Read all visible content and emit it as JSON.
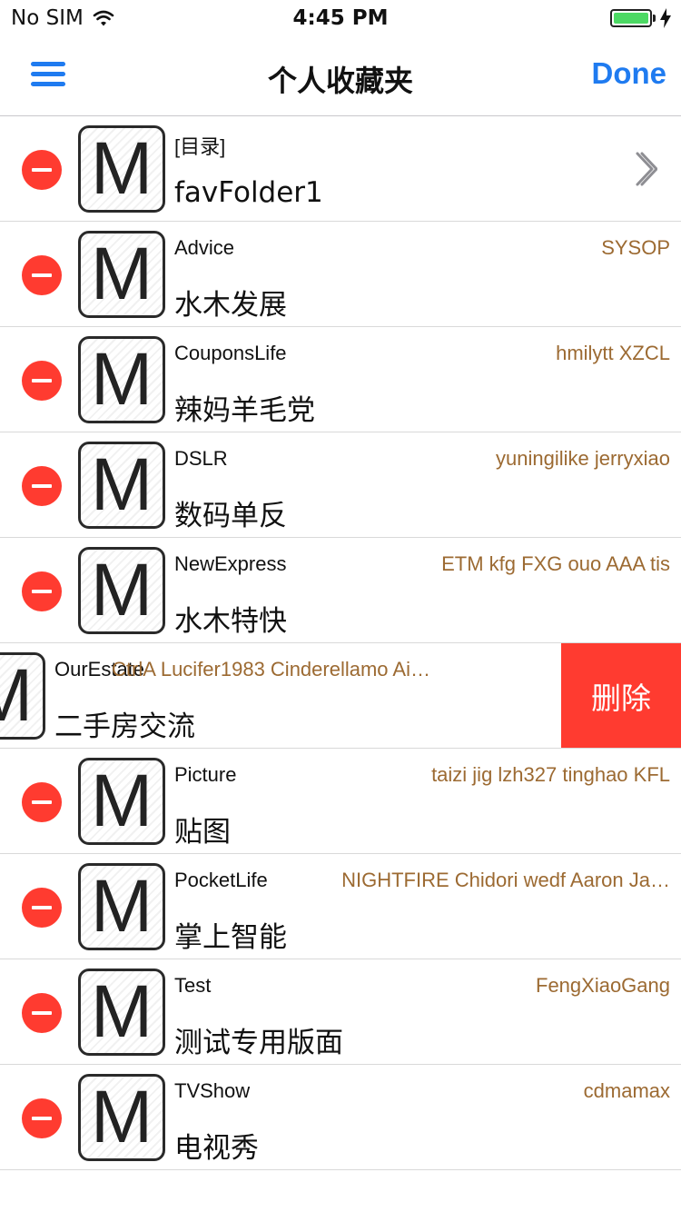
{
  "status": {
    "carrier": "No SIM",
    "time": "4:45 PM",
    "battery_level": 1.0
  },
  "nav": {
    "title": "个人收藏夹",
    "done_label": "Done",
    "menu_icon": "hamburger-menu-icon"
  },
  "colors": {
    "accent": "#1f7bf0",
    "delete": "#ff3b30",
    "moderator_text": "#9c6a32"
  },
  "rows": [
    {
      "name": "[目录]",
      "title": "favFolder1",
      "moderators": "",
      "icon_letter": "M",
      "is_folder": true
    },
    {
      "name": "Advice",
      "title": "水木发展",
      "moderators": "SYSOP",
      "icon_letter": "M"
    },
    {
      "name": "CouponsLife",
      "title": "辣妈羊毛党",
      "moderators": "hmilytt XZCL",
      "icon_letter": "M"
    },
    {
      "name": "DSLR",
      "title": "数码单反",
      "moderators": "yuningilike jerryxiao",
      "icon_letter": "M"
    },
    {
      "name": "NewExpress",
      "title": "水木特快",
      "moderators": "ETM kfg FXG ouo AAA tis",
      "icon_letter": "M"
    },
    {
      "name": "OurEstate",
      "title": "二手房交流",
      "moderators": "CtrlA Lucifer1983 Cinderellamo Ai…",
      "icon_letter": "M",
      "swiped": true,
      "delete_label": "删除"
    },
    {
      "name": "Picture",
      "title": "贴图",
      "moderators": "taizi jig lzh327 tinghao KFL",
      "icon_letter": "M"
    },
    {
      "name": "PocketLife",
      "title": "掌上智能",
      "moderators": "NIGHTFIRE Chidori wedf Aaron Ja…",
      "icon_letter": "M"
    },
    {
      "name": "Test",
      "title": "测试专用版面",
      "moderators": "FengXiaoGang",
      "icon_letter": "M"
    },
    {
      "name": "TVShow",
      "title": "电视秀",
      "moderators": "cdmamax",
      "icon_letter": "M"
    }
  ]
}
